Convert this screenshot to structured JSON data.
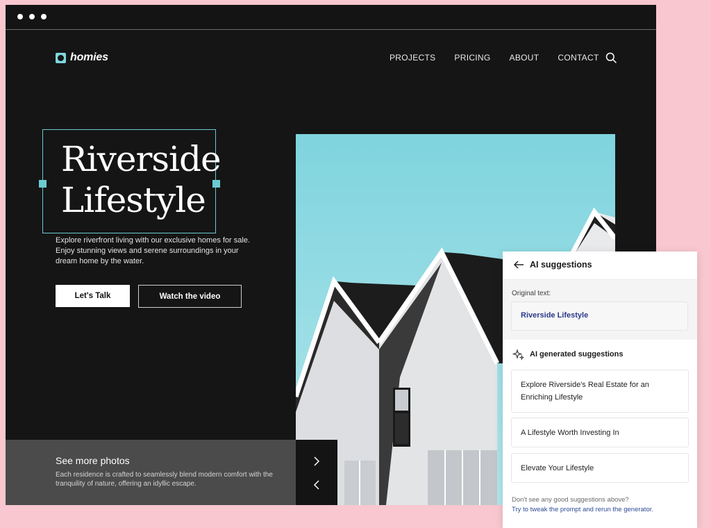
{
  "window": {
    "dots": 3
  },
  "header": {
    "logo_text": "homies",
    "nav": [
      "PROJECTS",
      "PRICING",
      "ABOUT",
      "CONTACT"
    ]
  },
  "hero": {
    "title_line1": "Riverside",
    "title_line2": "Lifestyle",
    "description": "Explore riverfront living with our exclusive homes for sale. Enjoy stunning views and serene surroundings in your dream home by the water.",
    "primary_cta": "Let's Talk",
    "secondary_cta": "Watch the video"
  },
  "more_photos": {
    "title": "See more photos",
    "description": "Each residence is crafted to seamlessly blend modern comfort with the tranquility of nature, offering an idyllic escape."
  },
  "ai_panel": {
    "title": "AI suggestions",
    "original_label": "Original text:",
    "original_value": "Riverside Lifestyle",
    "generated_title": "AI generated suggestions",
    "suggestions": [
      "Explore Riverside's Real Estate for an Enriching Lifestyle",
      "A Lifestyle Worth Investing In",
      "Elevate Your Lifestyle"
    ],
    "footer_line1": "Don't see any good suggestions above?",
    "footer_line2": "Try to tweak the prompt and rerun the generator."
  },
  "colors": {
    "page_bg": "#f9c7cf",
    "site_bg": "#151515",
    "accent": "#6bcbd3",
    "link": "#2e4a96"
  }
}
